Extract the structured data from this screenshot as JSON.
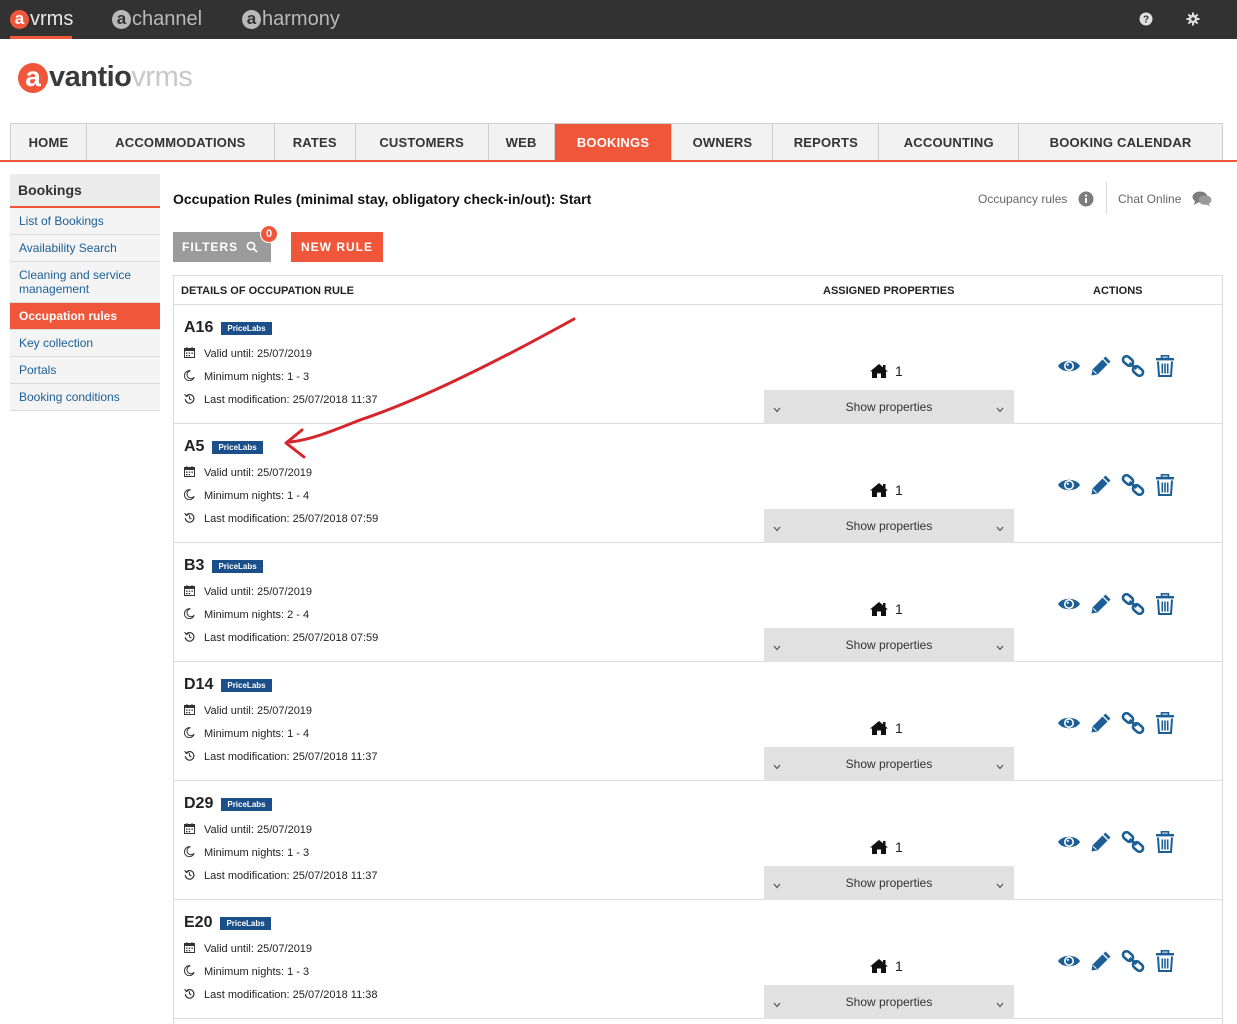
{
  "topbar": {
    "brands": [
      {
        "glyph": "a",
        "label": "vrms"
      },
      {
        "glyph": "a",
        "label": "channel"
      },
      {
        "glyph": "a",
        "label": "harmony"
      }
    ],
    "icons": [
      "help-icon",
      "settings-icon"
    ]
  },
  "logo": {
    "glyph": "a",
    "main": "vantio",
    "suffix": "vrms"
  },
  "nav": {
    "items": [
      "HOME",
      "ACCOMMODATIONS",
      "RATES",
      "CUSTOMERS",
      "WEB",
      "BOOKINGS",
      "OWNERS",
      "REPORTS",
      "ACCOUNTING",
      "BOOKING CALENDAR"
    ],
    "active": "BOOKINGS"
  },
  "sidebar": {
    "title": "Bookings",
    "items": [
      "List of Bookings",
      "Availability Search",
      "Cleaning and service management",
      "Occupation rules",
      "Key collection",
      "Portals",
      "Booking conditions"
    ],
    "active": "Occupation rules"
  },
  "page": {
    "title": "Occupation Rules (minimal stay, obligatory check-in/out): Start",
    "occupancy_link": "Occupancy rules",
    "chat_link": "Chat Online",
    "filters_label": "FILTERS",
    "filters_count": "0",
    "new_rule_label": "NEW RULE"
  },
  "table": {
    "headers": {
      "details": "DETAILS OF OCCUPATION RULE",
      "assigned": "ASSIGNED PROPERTIES",
      "actions": "ACTIONS"
    },
    "rows": [
      {
        "code": "A16",
        "tag": "PriceLabs",
        "valid": "Valid until: 25/07/2019",
        "nights": "Minimum nights: 1 - 3",
        "modified": "Last modification: 25/07/2018 11:37",
        "count": "1",
        "show": "Show properties"
      },
      {
        "code": "A5",
        "tag": "PriceLabs",
        "valid": "Valid until: 25/07/2019",
        "nights": "Minimum nights: 1 - 4",
        "modified": "Last modification: 25/07/2018 07:59",
        "count": "1",
        "show": "Show properties"
      },
      {
        "code": "B3",
        "tag": "PriceLabs",
        "valid": "Valid until: 25/07/2019",
        "nights": "Minimum nights: 2 - 4",
        "modified": "Last modification: 25/07/2018 07:59",
        "count": "1",
        "show": "Show properties"
      },
      {
        "code": "D14",
        "tag": "PriceLabs",
        "valid": "Valid until: 25/07/2019",
        "nights": "Minimum nights: 1 - 4",
        "modified": "Last modification: 25/07/2018 11:37",
        "count": "1",
        "show": "Show properties"
      },
      {
        "code": "D29",
        "tag": "PriceLabs",
        "valid": "Valid until: 25/07/2019",
        "nights": "Minimum nights: 1 - 3",
        "modified": "Last modification: 25/07/2018 11:37",
        "count": "1",
        "show": "Show properties"
      },
      {
        "code": "E20",
        "tag": "PriceLabs",
        "valid": "Valid until: 25/07/2019",
        "nights": "Minimum nights: 1 - 3",
        "modified": "Last modification: 25/07/2018 11:38",
        "count": "1",
        "show": "Show properties"
      }
    ],
    "row_icons": [
      "calendar-icon",
      "moon-icon",
      "history-icon"
    ],
    "action_icons": [
      "view-eye-icon",
      "edit-pencil-icon",
      "link-icon",
      "delete-trash-icon"
    ]
  },
  "colors": {
    "brand": "#f0573a",
    "topbar": "#323232",
    "tag": "#1b4f8a",
    "link": "#1b5f96",
    "action": "#1b5f96",
    "annotation": "#d7262b"
  }
}
